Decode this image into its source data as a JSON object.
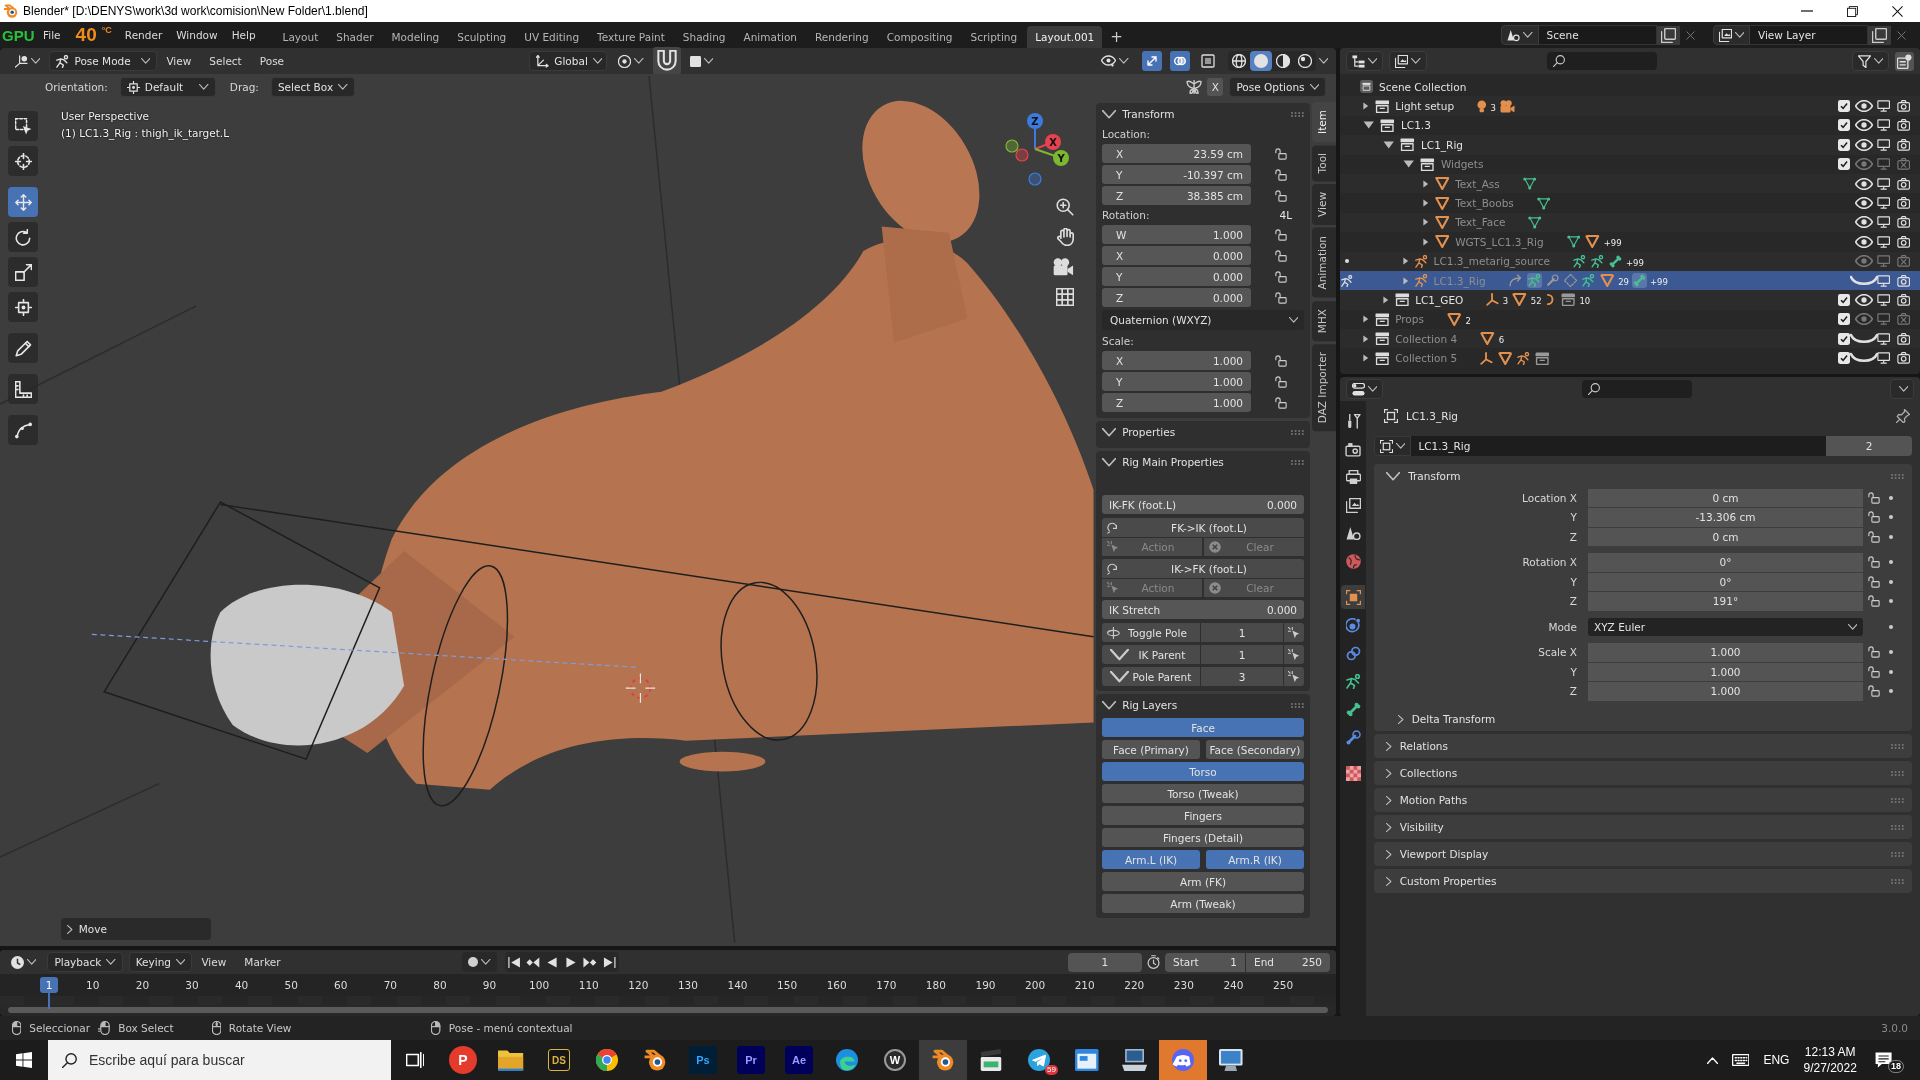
{
  "window": {
    "title": "Blender* [D:\\DENYS\\work\\3d work\\comision\\New Folder\\1.blend]"
  },
  "gpu_monitor": {
    "label": "GPU",
    "temperature": "40",
    "unit": "°C"
  },
  "menus": [
    "File",
    "Render",
    "Window",
    "Help"
  ],
  "workspaces": [
    {
      "label": "Layout",
      "selected": false
    },
    {
      "label": "Shader",
      "selected": false
    },
    {
      "label": "Modeling",
      "selected": false
    },
    {
      "label": "Sculpting",
      "selected": false
    },
    {
      "label": "UV Editing",
      "selected": false
    },
    {
      "label": "Texture Paint",
      "selected": false
    },
    {
      "label": "Shading",
      "selected": false
    },
    {
      "label": "Animation",
      "selected": false
    },
    {
      "label": "Rendering",
      "selected": false
    },
    {
      "label": "Compositing",
      "selected": false
    },
    {
      "label": "Scripting",
      "selected": false
    },
    {
      "label": "Layout.001",
      "selected": true
    }
  ],
  "add_workspace": "+",
  "scene": "Scene",
  "view_layer": "View Layer",
  "viewport": {
    "mode": "Pose Mode",
    "menus": [
      "View",
      "Select",
      "Pose"
    ],
    "orientation": "Global",
    "toggles": [
      {
        "kind": "gizmos",
        "on": true
      },
      {
        "kind": "overlays",
        "on": true
      },
      {
        "kind": "xray",
        "on": false
      }
    ],
    "shading": [
      {
        "kind": "wireframe",
        "selected": false
      },
      {
        "kind": "solid",
        "selected": true
      },
      {
        "kind": "material",
        "selected": false
      },
      {
        "kind": "rendered",
        "selected": false
      }
    ],
    "tool_settings": {
      "orientation_label": "Orientation:",
      "orientation": "Default",
      "drag_label": "Drag:",
      "drag": "Select Box",
      "mirror": {
        "label": "X",
        "on": false
      },
      "options": "Pose Options"
    },
    "tools": [
      {
        "kind": "select_box",
        "selected": false
      },
      {
        "kind": "cursor",
        "selected": false
      },
      {
        "kind": "move",
        "selected": true
      },
      {
        "kind": "rotate",
        "selected": false
      },
      {
        "kind": "scale",
        "selected": false
      },
      {
        "kind": "transform",
        "selected": false
      },
      {
        "kind": "annotate",
        "selected": false
      },
      {
        "kind": "measure",
        "selected": false
      },
      {
        "kind": "bend",
        "selected": false
      }
    ],
    "view_name": "User Perspective",
    "active_object": "(1) LC1.3_Rig : thigh_ik_target.L",
    "axes": [
      {
        "label": "Z",
        "color": "#3b7be0"
      },
      {
        "label": "X",
        "color": "#e8424e"
      },
      {
        "label": "Y",
        "color": "#7cb82f"
      }
    ],
    "last_operator": "Move"
  },
  "sidebar": {
    "tabs": [
      {
        "label": "Item",
        "selected": true
      },
      {
        "label": "Tool",
        "selected": false
      },
      {
        "label": "View",
        "selected": false
      },
      {
        "label": "Animation",
        "selected": false
      },
      {
        "label": "MHX",
        "selected": false
      },
      {
        "label": "DAZ Importer",
        "selected": false
      }
    ],
    "panels": [
      {
        "kind": "transform",
        "title": "Transform",
        "expanded": true,
        "groups": [
          {
            "label": "Location:",
            "fields": [
              {
                "axis": "X",
                "value": "23.59 cm"
              },
              {
                "axis": "Y",
                "value": "-10.397 cm"
              },
              {
                "axis": "Z",
                "value": "38.385 cm"
              }
            ]
          },
          {
            "label": "Rotation:",
            "lock_label": "4L",
            "fields": [
              {
                "axis": "W",
                "value": "1.000"
              },
              {
                "axis": "X",
                "value": "0.000"
              },
              {
                "axis": "Y",
                "value": "0.000"
              },
              {
                "axis": "Z",
                "value": "0.000"
              }
            ],
            "mode": "Quaternion (WXYZ)"
          },
          {
            "label": "Scale:",
            "fields": [
              {
                "axis": "X",
                "value": "1.000"
              },
              {
                "axis": "Y",
                "value": "1.000"
              },
              {
                "axis": "Z",
                "value": "1.000"
              }
            ]
          }
        ]
      },
      {
        "kind": "empty",
        "title": "Properties",
        "expanded": true
      },
      {
        "kind": "rig_main",
        "title": "Rig Main Properties",
        "expanded": true,
        "items": [
          {
            "kind": "slider",
            "label": "IK-FK (foot.L)",
            "value": "0.000"
          },
          {
            "kind": "operator",
            "label": "FK->IK (foot.L)"
          },
          {
            "kind": "action_clear",
            "action": "Action",
            "clear": "Clear",
            "disabled": true
          },
          {
            "kind": "operator",
            "label": "IK->FK (foot.L)"
          },
          {
            "kind": "action_clear",
            "action": "Action",
            "clear": "Clear",
            "disabled": true
          },
          {
            "kind": "slider",
            "label": "IK Stretch",
            "value": "0.000"
          },
          {
            "kind": "toggle",
            "label": "Toggle Pole",
            "value": "1"
          },
          {
            "kind": "enum",
            "label": "IK Parent",
            "value": "1"
          },
          {
            "kind": "enum",
            "label": "Pole Parent",
            "value": "3"
          }
        ]
      },
      {
        "kind": "layers",
        "title": "Rig Layers",
        "expanded": true,
        "rows": [
          {
            "buttons": [
              {
                "label": "Face",
                "selected": true
              }
            ]
          },
          {
            "buttons": [
              {
                "label": "Face (Primary)",
                "selected": false
              },
              {
                "label": "Face (Secondary)",
                "selected": false
              }
            ]
          },
          {
            "buttons": [
              {
                "label": "Torso",
                "selected": true
              }
            ]
          },
          {
            "buttons": [
              {
                "label": "Torso (Tweak)",
                "selected": false
              }
            ]
          },
          {
            "buttons": [
              {
                "label": "Fingers",
                "selected": false
              }
            ]
          },
          {
            "buttons": [
              {
                "label": "Fingers (Detail)",
                "selected": false
              }
            ]
          },
          {
            "buttons": [
              {
                "label": "Arm.L (IK)",
                "selected": true
              },
              {
                "label": "Arm.R (IK)",
                "selected": true
              }
            ]
          },
          {
            "buttons": [
              {
                "label": "Arm (FK)",
                "selected": false
              }
            ]
          },
          {
            "buttons": [
              {
                "label": "Arm (Tweak)",
                "selected": false
              }
            ]
          }
        ]
      }
    ]
  },
  "outliner": {
    "tree": [
      {
        "name": "Scene Collection",
        "kind": "scene_collection",
        "selected": false,
        "dim": false,
        "children": [
          {
            "name": "Light setup",
            "kind": "collection",
            "expanded": false,
            "selected": false,
            "dim": false,
            "checked": true,
            "visible": true,
            "viewport": true,
            "render": true,
            "badges": [
              {
                "kind": "light",
                "count": "3"
              },
              {
                "kind": "camera"
              }
            ]
          },
          {
            "name": "LC1.3",
            "kind": "collection",
            "expanded": true,
            "selected": false,
            "dim": false,
            "checked": true,
            "visible": true,
            "viewport": true,
            "render": true,
            "children": [
              {
                "name": "LC1_Rig",
                "kind": "collection",
                "expanded": true,
                "selected": false,
                "dim": false,
                "checked": true,
                "visible": true,
                "viewport": true,
                "render": true,
                "children": [
                  {
                    "name": "Widgets",
                    "kind": "collection",
                    "expanded": true,
                    "selected": false,
                    "dim": true,
                    "checked": true,
                    "visible": true,
                    "viewport": false,
                    "render": false,
                    "children": [
                      {
                        "name": "Text_Ass",
                        "kind": "mesh",
                        "expanded": false,
                        "selected": false,
                        "dim": true,
                        "visible": true,
                        "viewport": true,
                        "render": true,
                        "badges": [
                          {
                            "kind": "mesh_data"
                          }
                        ]
                      },
                      {
                        "name": "Text_Boobs",
                        "kind": "mesh",
                        "expanded": false,
                        "selected": false,
                        "dim": true,
                        "visible": true,
                        "viewport": true,
                        "render": true,
                        "badges": [
                          {
                            "kind": "mesh_data"
                          }
                        ]
                      },
                      {
                        "name": "Text_Face",
                        "kind": "mesh",
                        "expanded": false,
                        "selected": false,
                        "dim": true,
                        "visible": true,
                        "viewport": true,
                        "render": true,
                        "badges": [
                          {
                            "kind": "mesh_data"
                          }
                        ]
                      },
                      {
                        "name": "WGTS_LC1.3_Rig",
                        "kind": "mesh",
                        "expanded": false,
                        "selected": false,
                        "dim": true,
                        "visible": true,
                        "viewport": true,
                        "render": true,
                        "badges": [
                          {
                            "kind": "mesh_data"
                          },
                          {
                            "kind": "mesh",
                            "count": "+99"
                          }
                        ]
                      }
                    ]
                  },
                  {
                    "name": "LC1.3_metarig_source",
                    "kind": "armature",
                    "expanded": false,
                    "selected": false,
                    "dim": true,
                    "visible": true,
                    "viewport": false,
                    "render": false,
                    "mode_marker": {
                      "kind": "dot"
                    },
                    "badges": [
                      {
                        "kind": "pose"
                      },
                      {
                        "kind": "pose"
                      },
                      {
                        "kind": "bone",
                        "count": "+99"
                      }
                    ]
                  },
                  {
                    "name": "LC1.3_Rig",
                    "kind": "armature",
                    "expanded": false,
                    "selected": true,
                    "dim": true,
                    "visible": false,
                    "viewport": true,
                    "render": true,
                    "mode_marker": {
                      "kind": "pose"
                    },
                    "badges": [
                      {
                        "kind": "action",
                        "active": false
                      },
                      {
                        "kind": "pose",
                        "active": true
                      },
                      {
                        "kind": "bone_constraint",
                        "active": false
                      },
                      {
                        "kind": "custom",
                        "active": false
                      },
                      {
                        "kind": "pose",
                        "active": false
                      },
                      {
                        "kind": "mesh",
                        "count": "29",
                        "active": false
                      },
                      {
                        "kind": "bone",
                        "count": "+99",
                        "active": true
                      }
                    ]
                  }
                ]
              },
              {
                "name": "LC1_GEO",
                "kind": "collection",
                "expanded": false,
                "selected": false,
                "dim": false,
                "checked": true,
                "visible": true,
                "viewport": true,
                "render": true,
                "badges": [
                  {
                    "kind": "empty",
                    "count": "3"
                  },
                  {
                    "kind": "mesh",
                    "count": "52"
                  },
                  {
                    "kind": "curve"
                  },
                  {
                    "kind": "collection",
                    "count": "10"
                  }
                ]
              }
            ]
          },
          {
            "name": "Props",
            "kind": "collection",
            "expanded": false,
            "selected": false,
            "dim": true,
            "checked": true,
            "visible": true,
            "viewport": false,
            "render": false,
            "badges": [
              {
                "kind": "mesh",
                "count": "2"
              }
            ]
          },
          {
            "name": "Collection 4",
            "kind": "collection",
            "expanded": false,
            "selected": false,
            "dim": true,
            "checked": true,
            "visible": false,
            "viewport": true,
            "render": true,
            "badges": [
              {
                "kind": "mesh",
                "count": "6"
              }
            ]
          },
          {
            "name": "Collection 5",
            "kind": "collection",
            "expanded": false,
            "selected": false,
            "dim": true,
            "checked": true,
            "visible": false,
            "viewport": true,
            "render": true,
            "badges": [
              {
                "kind": "empty"
              },
              {
                "kind": "mesh"
              },
              {
                "kind": "armature"
              },
              {
                "kind": "collection"
              }
            ]
          }
        ]
      }
    ]
  },
  "properties": {
    "tabs": [
      {
        "kind": "tool",
        "selected": false
      },
      {
        "kind": "render",
        "selected": false
      },
      {
        "kind": "output",
        "selected": false
      },
      {
        "kind": "view_layer",
        "selected": false
      },
      {
        "kind": "scene",
        "selected": false
      },
      {
        "kind": "world",
        "selected": false
      },
      {
        "kind": "object",
        "selected": true
      },
      {
        "kind": "physics",
        "selected": false
      },
      {
        "kind": "object_constraint",
        "selected": false
      },
      {
        "kind": "armature_data",
        "selected": false
      },
      {
        "kind": "bone",
        "selected": false
      },
      {
        "kind": "bone_constraint",
        "selected": false
      },
      {
        "kind": "texture",
        "selected": false
      }
    ],
    "context": "LC1.3_Rig",
    "datablock": {
      "name": "LC1.3_Rig",
      "users": "2"
    },
    "panels": [
      {
        "title": "Transform",
        "expanded": true,
        "groups": [
          {
            "rows": [
              {
                "kind": "number",
                "label": "Location X",
                "value": "0 cm"
              },
              {
                "kind": "number",
                "label": "Y",
                "value": "-13.306 cm"
              },
              {
                "kind": "number",
                "label": "Z",
                "value": "0 cm"
              }
            ]
          },
          {
            "rows": [
              {
                "kind": "number",
                "label": "Rotation X",
                "value": "0°"
              },
              {
                "kind": "number",
                "label": "Y",
                "value": "0°"
              },
              {
                "kind": "number",
                "label": "Z",
                "value": "191°"
              }
            ]
          },
          {
            "rows": [
              {
                "kind": "enum",
                "label": "Mode",
                "value": "XYZ Euler"
              }
            ]
          },
          {
            "rows": [
              {
                "kind": "number",
                "label": "Scale X",
                "value": "1.000"
              },
              {
                "kind": "number",
                "label": "Y",
                "value": "1.000"
              },
              {
                "kind": "number",
                "label": "Z",
                "value": "1.000"
              }
            ]
          }
        ],
        "subpanels": [
          {
            "title": "Delta Transform",
            "expanded": false
          }
        ]
      },
      {
        "title": "Relations",
        "expanded": false
      },
      {
        "title": "Collections",
        "expanded": false
      },
      {
        "title": "Motion Paths",
        "expanded": false
      },
      {
        "title": "Visibility",
        "expanded": false
      },
      {
        "title": "Viewport Display",
        "expanded": false
      },
      {
        "title": "Custom Properties",
        "expanded": false
      }
    ]
  },
  "timeline": {
    "menus": [
      {
        "label": "Playback",
        "kind": "dropdown"
      },
      {
        "label": "Keying",
        "kind": "dropdown"
      },
      {
        "label": "View",
        "kind": "menu"
      },
      {
        "label": "Marker",
        "kind": "menu"
      }
    ],
    "auto_keying": false,
    "controls": [
      {
        "kind": "jump_start"
      },
      {
        "kind": "prev_keyframe"
      },
      {
        "kind": "play_reverse"
      },
      {
        "kind": "play"
      },
      {
        "kind": "next_keyframe"
      },
      {
        "kind": "jump_end"
      }
    ],
    "current_frame": "1",
    "start_label": "Start",
    "start": "1",
    "end_label": "End",
    "end": "250",
    "playhead": "1",
    "ruler": [
      "10",
      "20",
      "30",
      "40",
      "50",
      "60",
      "70",
      "80",
      "90",
      "100",
      "110",
      "120",
      "130",
      "140",
      "150",
      "160",
      "170",
      "180",
      "190",
      "200",
      "210",
      "220",
      "230",
      "240",
      "250"
    ]
  },
  "status_bar": {
    "hints": [
      {
        "kind": "left_click",
        "label": "Seleccionar"
      },
      {
        "kind": "left_drag",
        "label": "Box Select"
      },
      {
        "kind": "middle_click",
        "label": "Rotate View"
      },
      {
        "kind": "right_click",
        "label": "Pose - menú contextual"
      }
    ],
    "version": "3.0.0"
  },
  "taskbar": {
    "search_placeholder": "Escribe aquí para buscar",
    "apps": [
      {
        "kind": "letter_red_circle",
        "label": "P",
        "active": false,
        "flashing": false
      },
      {
        "kind": "folder",
        "active": false,
        "flashing": false
      },
      {
        "kind": "letter_gold_tile",
        "label": "DS",
        "active": false,
        "flashing": false
      },
      {
        "kind": "chrome",
        "active": false,
        "flashing": false
      },
      {
        "kind": "blender",
        "active": false,
        "flashing": false
      },
      {
        "kind": "letter_blue_tile",
        "label": "Ps",
        "active": false,
        "flashing": false
      },
      {
        "kind": "letter_violet_tile",
        "label": "Pr",
        "active": false,
        "flashing": false
      },
      {
        "kind": "letter_violet_tile",
        "label": "Ae",
        "active": false,
        "flashing": false
      },
      {
        "kind": "edge",
        "active": false,
        "flashing": false
      },
      {
        "kind": "letter_grey_circle",
        "label": "W",
        "active": false,
        "flashing": false
      },
      {
        "kind": "blender",
        "active": true,
        "flashing": false
      },
      {
        "kind": "clapper",
        "active": false,
        "flashing": false
      },
      {
        "kind": "telegram",
        "badge": "59",
        "active": false,
        "flashing": false
      },
      {
        "kind": "window_app",
        "active": false,
        "flashing": false
      },
      {
        "kind": "computer_app",
        "active": false,
        "flashing": false
      },
      {
        "kind": "chat",
        "active": false,
        "flashing": true
      },
      {
        "kind": "monitor_app",
        "active": false,
        "flashing": false
      }
    ],
    "tray": {
      "language": "ENG",
      "time": "12:13 AM",
      "date": "9/27/2022",
      "notifications": "18"
    }
  }
}
